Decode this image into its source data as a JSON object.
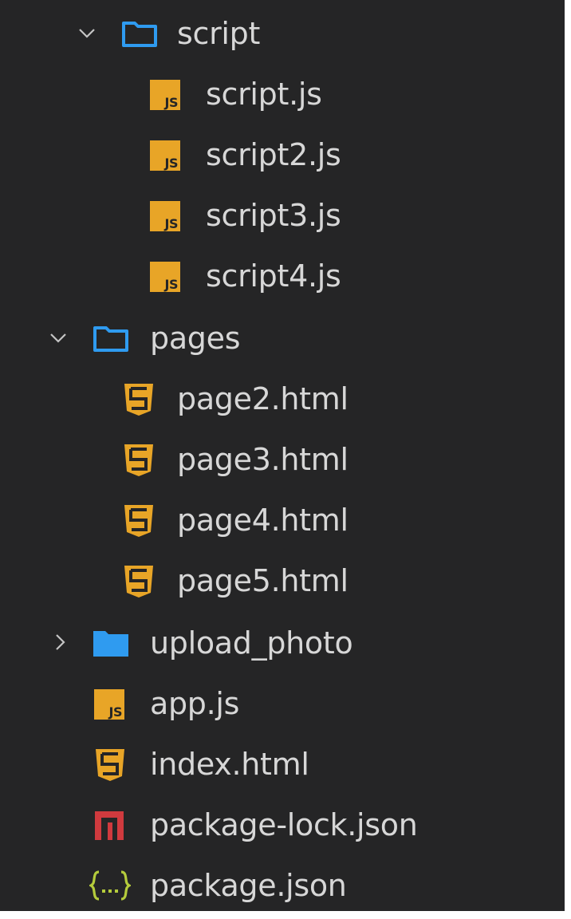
{
  "tree": {
    "script_folder": {
      "label": "script",
      "state": "expanded",
      "icon": "folder-open-icon"
    },
    "script_files": [
      {
        "label": "script.js",
        "icon": "js-icon"
      },
      {
        "label": "script2.js",
        "icon": "js-icon"
      },
      {
        "label": "script3.js",
        "icon": "js-icon"
      },
      {
        "label": "script4.js",
        "icon": "js-icon"
      }
    ],
    "pages_folder": {
      "label": "pages",
      "state": "expanded",
      "icon": "folder-open-icon"
    },
    "pages_files": [
      {
        "label": "page2.html",
        "icon": "html5-icon"
      },
      {
        "label": "page3.html",
        "icon": "html5-icon"
      },
      {
        "label": "page4.html",
        "icon": "html5-icon"
      },
      {
        "label": "page5.html",
        "icon": "html5-icon"
      }
    ],
    "upload_folder": {
      "label": "upload_photo",
      "state": "collapsed",
      "icon": "folder-closed-icon"
    },
    "root_files": [
      {
        "label": "app.js",
        "icon": "js-icon"
      },
      {
        "label": "index.html",
        "icon": "html5-icon"
      },
      {
        "label": "package-lock.json",
        "icon": "npm-icon"
      },
      {
        "label": "package.json",
        "icon": "json-braces-icon"
      }
    ]
  },
  "colors": {
    "background": "#252526",
    "text": "#d7d7d7",
    "folder": "#2f9bf0",
    "js": "#e8a527",
    "html": "#e8a527",
    "npm": "#d03a3e",
    "json": "#b5cc3c"
  }
}
